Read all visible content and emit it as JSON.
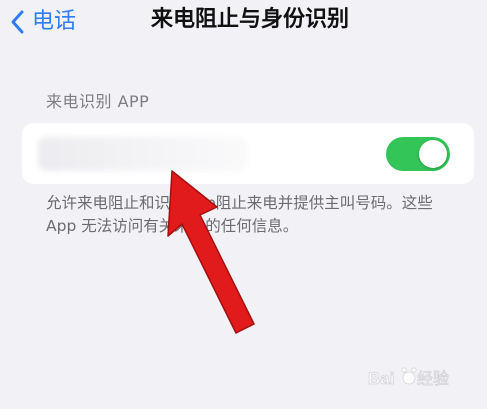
{
  "nav": {
    "back_label": "电话",
    "title": "来电阻止与身份识别"
  },
  "section": {
    "header": "来电识别 APP",
    "footer": "允许来电阻止和识别App阻止来电并提供主叫号码。这些 App 无法访问有关来电的任何信息。"
  },
  "app_row": {
    "toggle_on": true
  },
  "watermark": {
    "text": "Baidu经验"
  },
  "colors": {
    "accent": "#2f7cf6",
    "toggle_on": "#33c558",
    "background": "#f2f1f6",
    "arrow": "#e11b1b"
  }
}
